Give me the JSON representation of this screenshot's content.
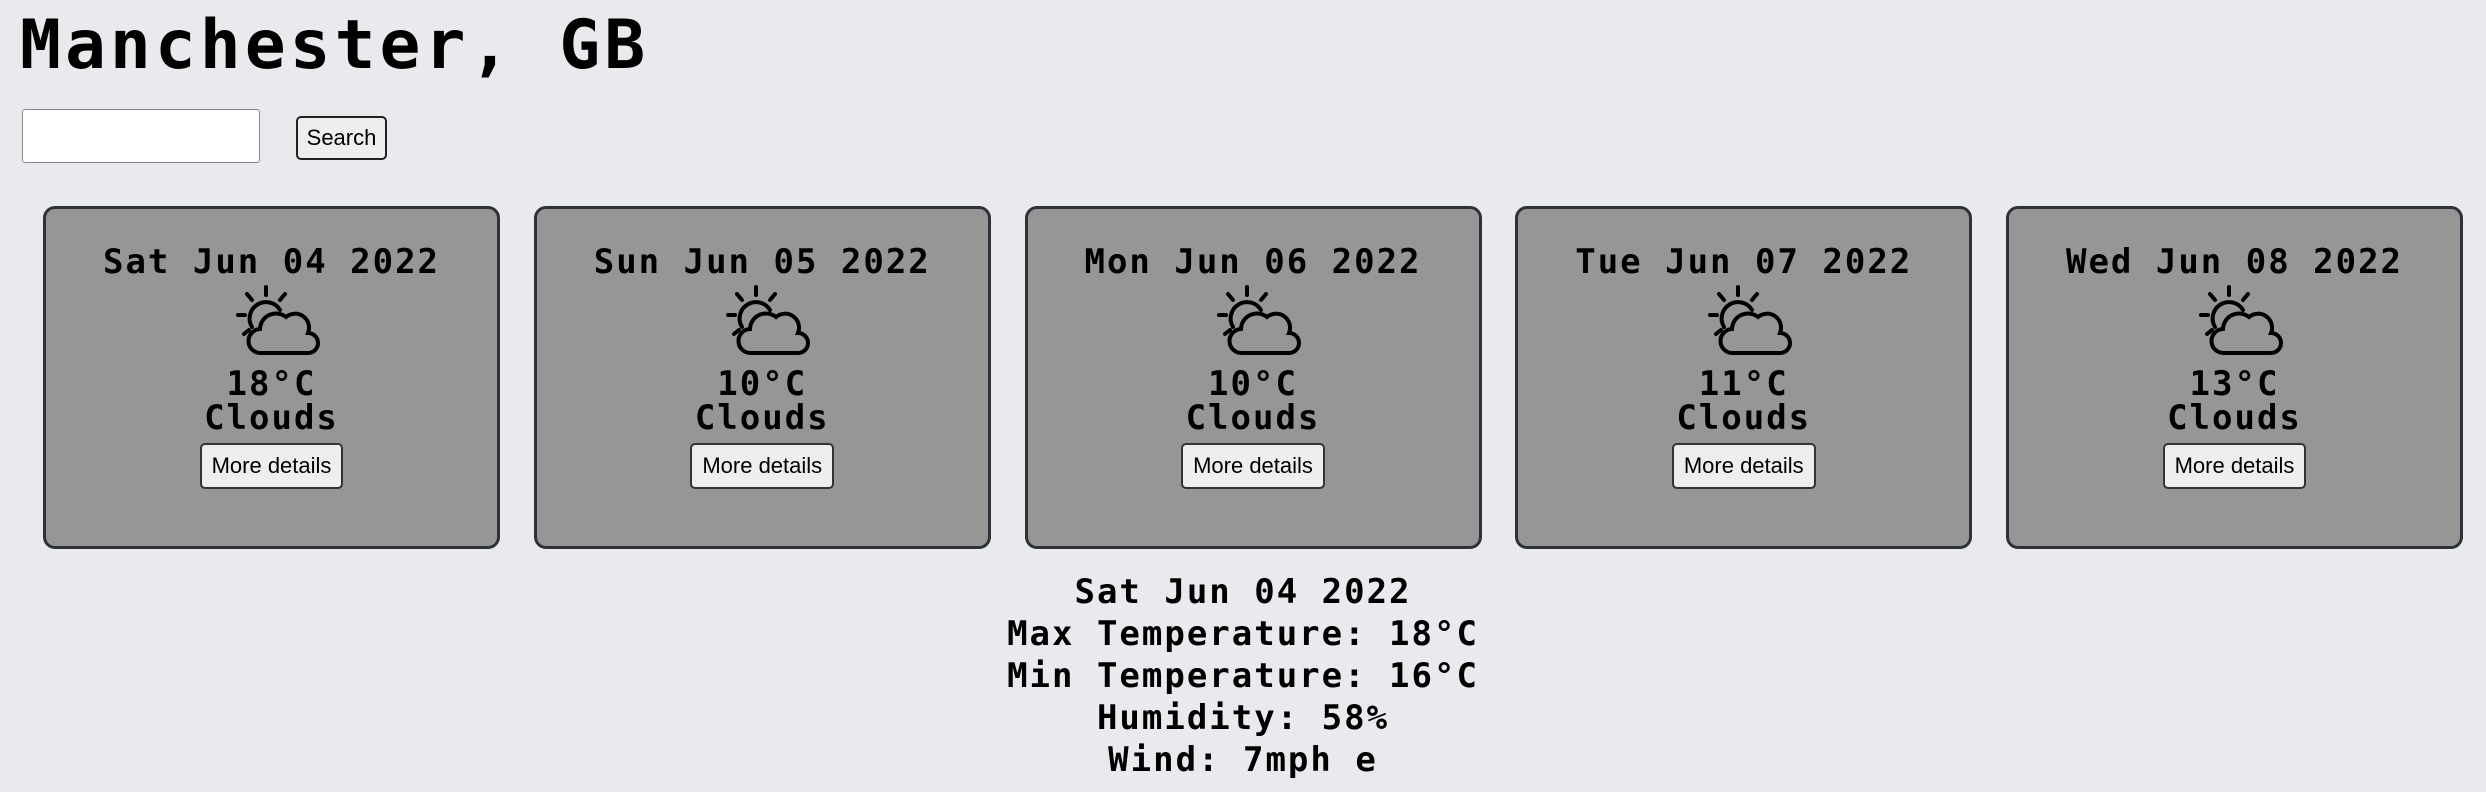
{
  "header": {
    "city": "Manchester, GB"
  },
  "search": {
    "value": "",
    "placeholder": "",
    "button_label": "Search"
  },
  "forecast": [
    {
      "date": "Sat Jun 04 2022",
      "icon": "sun-behind-cloud-icon",
      "temp": "18°C",
      "description": "Clouds",
      "button_label": "More details"
    },
    {
      "date": "Sun Jun 05 2022",
      "icon": "sun-behind-cloud-icon",
      "temp": "10°C",
      "description": "Clouds",
      "button_label": "More details"
    },
    {
      "date": "Mon Jun 06 2022",
      "icon": "sun-behind-cloud-icon",
      "temp": "10°C",
      "description": "Clouds",
      "button_label": "More details"
    },
    {
      "date": "Tue Jun 07 2022",
      "icon": "sun-behind-cloud-icon",
      "temp": "11°C",
      "description": "Clouds",
      "button_label": "More details"
    },
    {
      "date": "Wed Jun 08 2022",
      "icon": "sun-behind-cloud-icon",
      "temp": "13°C",
      "description": "Clouds",
      "button_label": "More details"
    }
  ],
  "details": {
    "date": "Sat Jun 04 2022",
    "max_temp": "Max Temperature: 18°C",
    "min_temp": "Min Temperature: 16°C",
    "humidity": "Humidity: 58%",
    "wind": "Wind: 7mph e"
  },
  "colors": {
    "page_background": "#e9eaee",
    "card_background": "#969696",
    "card_border": "#2e3238",
    "button_background": "#eeeeee"
  }
}
